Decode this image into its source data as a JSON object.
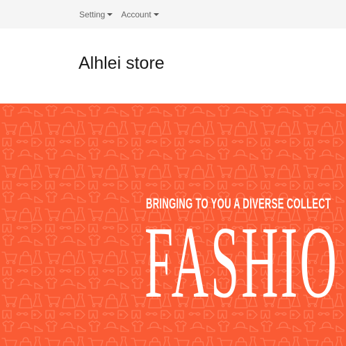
{
  "topnav": {
    "items": [
      {
        "label": "Setting"
      },
      {
        "label": "Account"
      }
    ]
  },
  "header": {
    "store_name": "Alhlei store"
  },
  "banner": {
    "tagline": "BRINGING TO YOU A DIVERSE COLLECT",
    "title": "FASHIO",
    "background_color": "#fa5b34",
    "pattern": "shopping-icons-pattern"
  }
}
